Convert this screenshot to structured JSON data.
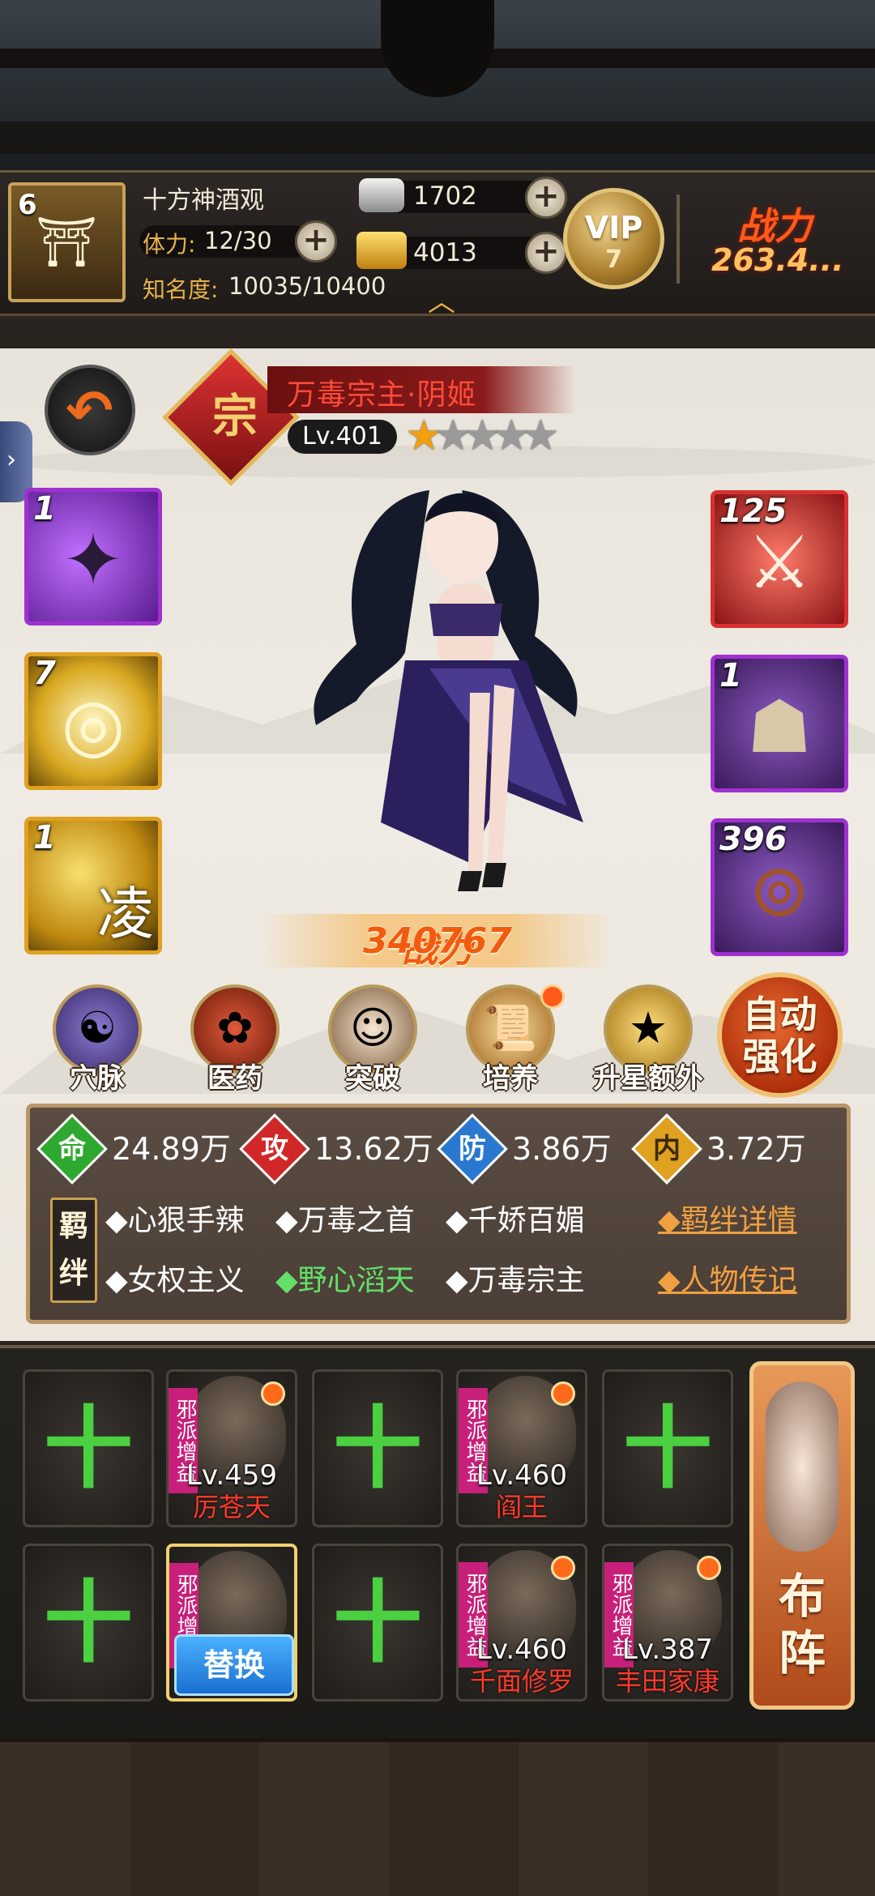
{
  "header": {
    "player_level": "6",
    "player_name": "十方神酒观",
    "stamina_label": "体力:",
    "stamina_value": "12/30",
    "fame_label": "知名度:",
    "fame_value": "10035/10400",
    "silver": "1702",
    "gold": "4013",
    "vip_label": "VIP",
    "vip_level": "7",
    "power_label": "战力",
    "power_value": "263.4..."
  },
  "hero": {
    "rank_badge": "宗",
    "name": "万毒宗主·阴姬",
    "level": "Lv.401",
    "stars_filled": 1,
    "stars_total": 5,
    "power_label": "战力",
    "power_value": "340767"
  },
  "skills_left": [
    {
      "count": "1",
      "icon": "shuriken-icon"
    },
    {
      "count": "7",
      "icon": "golden-swirl-icon"
    },
    {
      "count": "1",
      "icon": "boot-icon",
      "glyph": "凌"
    }
  ],
  "equips_right": [
    {
      "count": "125",
      "icon": "red-sword-icon"
    },
    {
      "count": "1",
      "icon": "cloak-icon"
    },
    {
      "count": "396",
      "icon": "prayer-beads-icon"
    }
  ],
  "functions": [
    {
      "label": "穴脉",
      "icon": "meridian-icon",
      "badge": false
    },
    {
      "label": "医药",
      "icon": "medicine-icon",
      "badge": false
    },
    {
      "label": "突破",
      "icon": "breakthrough-icon",
      "badge": false
    },
    {
      "label": "培养",
      "icon": "scroll-icon",
      "badge": true
    },
    {
      "label": "升星额外",
      "icon": "star-up-icon",
      "badge": false
    }
  ],
  "auto_button": "自动强化",
  "stats": [
    {
      "glyph": "命",
      "value": "24.89万",
      "color": "#2ea82e"
    },
    {
      "glyph": "攻",
      "value": "13.62万",
      "color": "#d02828"
    },
    {
      "glyph": "防",
      "value": "3.86万",
      "color": "#2a78d0"
    },
    {
      "glyph": "内",
      "value": "3.72万",
      "color": "#e0a020"
    }
  ],
  "bonds_label": "羁绊",
  "bonds_row1": [
    "◆心狠手辣",
    "◆万毒之首",
    "◆千娇百媚"
  ],
  "bonds_row2": [
    "◆女权主义",
    "◆野心滔天",
    "◆万毒宗主"
  ],
  "bond_detail_link": "◆羁绊详情",
  "biography_link": "◆人物传记",
  "formation": {
    "row1": [
      {
        "type": "empty"
      },
      {
        "type": "hero",
        "level": "Lv.459",
        "name": "厉苍天",
        "tag": "邪派增益"
      },
      {
        "type": "empty"
      },
      {
        "type": "hero",
        "level": "Lv.460",
        "name": "阎王",
        "tag": "邪派增益"
      },
      {
        "type": "empty"
      }
    ],
    "row2": [
      {
        "type": "empty"
      },
      {
        "type": "selected",
        "tag": "邪派增益",
        "swap": "替换"
      },
      {
        "type": "empty"
      },
      {
        "type": "hero",
        "level": "Lv.460",
        "name": "千面修罗",
        "tag": "邪派增益"
      },
      {
        "type": "hero",
        "level": "Lv.387",
        "name": "丰田家康",
        "tag": "邪派增益"
      }
    ],
    "deploy_label": "布阵",
    "plus_glyph": "十"
  }
}
